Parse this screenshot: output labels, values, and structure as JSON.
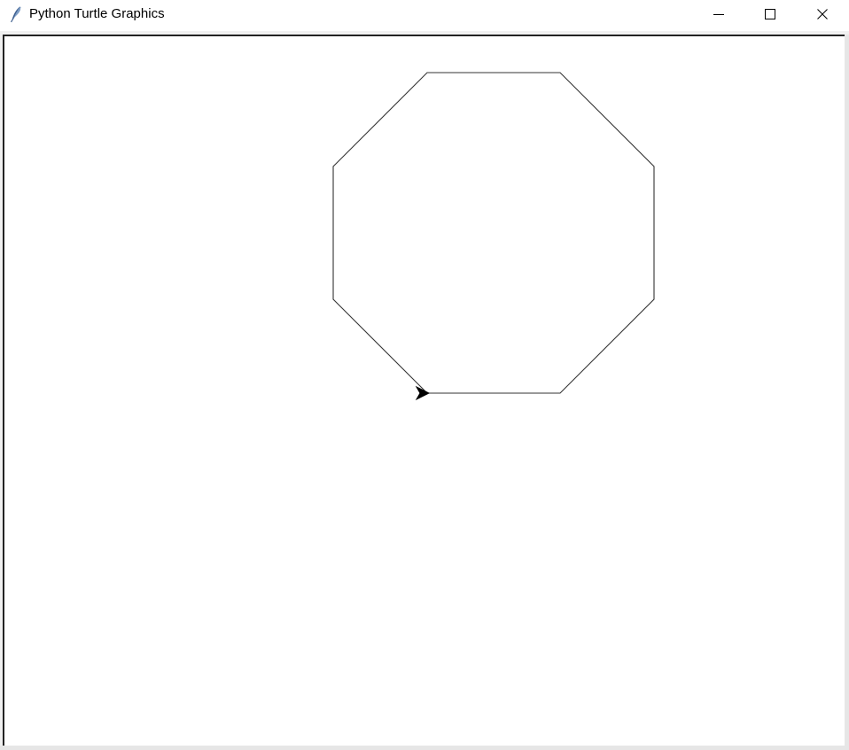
{
  "window": {
    "title": "Python Turtle Graphics",
    "app_icon": "feather-icon",
    "controls": {
      "minimize_icon": "minimize-icon",
      "maximize_icon": "maximize-icon",
      "close_icon": "close-icon"
    }
  },
  "canvas": {
    "background": "#ffffff",
    "shape": "octagon",
    "stroke_color": "#333333",
    "turtle_icon": "turtle-arrow-icon",
    "turtle_color": "#000000",
    "turtle_heading": "east"
  }
}
